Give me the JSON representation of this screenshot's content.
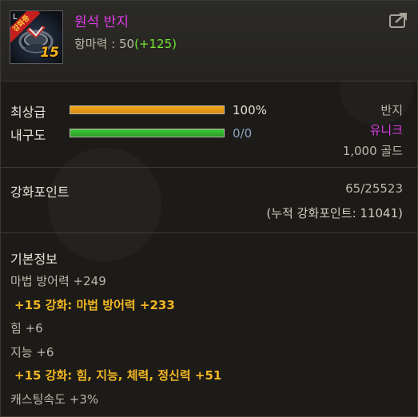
{
  "item": {
    "grade_corner": "L",
    "ribbon_text": "강화중",
    "level_badge": "15",
    "name": "원석 반지",
    "stat_label": "항마력 : 50",
    "stat_bonus": "(+125)"
  },
  "quality": {
    "label": "최상급",
    "value_text": "100%",
    "fill_fraction": 1.0
  },
  "durability": {
    "label": "내구도",
    "value_text": "0/0",
    "fill_fraction": 1.0
  },
  "info": {
    "type": "반지",
    "rarity": "유니크",
    "price": "1,000 골드"
  },
  "enhance_points": {
    "label": "강화포인트",
    "value": "65/25523",
    "cumulative": "(누적 강화포인트: 11041)"
  },
  "basic_info": {
    "title": "기본정보",
    "lines": [
      {
        "text": "마법 방어력 +249",
        "type": "stat"
      },
      {
        "text": "+15 강화: 마법 방어력 +233",
        "type": "enhance"
      },
      {
        "text": "힘 +6",
        "type": "stat"
      },
      {
        "text": "지능 +6",
        "type": "stat"
      },
      {
        "text": "+15 강화: 힘, 지능, 체력, 정신력 +51",
        "type": "enhance"
      },
      {
        "text": "캐스팅속도 +3%",
        "type": "stat"
      }
    ]
  },
  "colors": {
    "name": "#e03ae6",
    "bonus": "#73e633",
    "quality_fill": "#f0a81c",
    "durability_fill": "#3ec93a",
    "rarity": "#e03ae6",
    "enhance": "#f2b722"
  }
}
